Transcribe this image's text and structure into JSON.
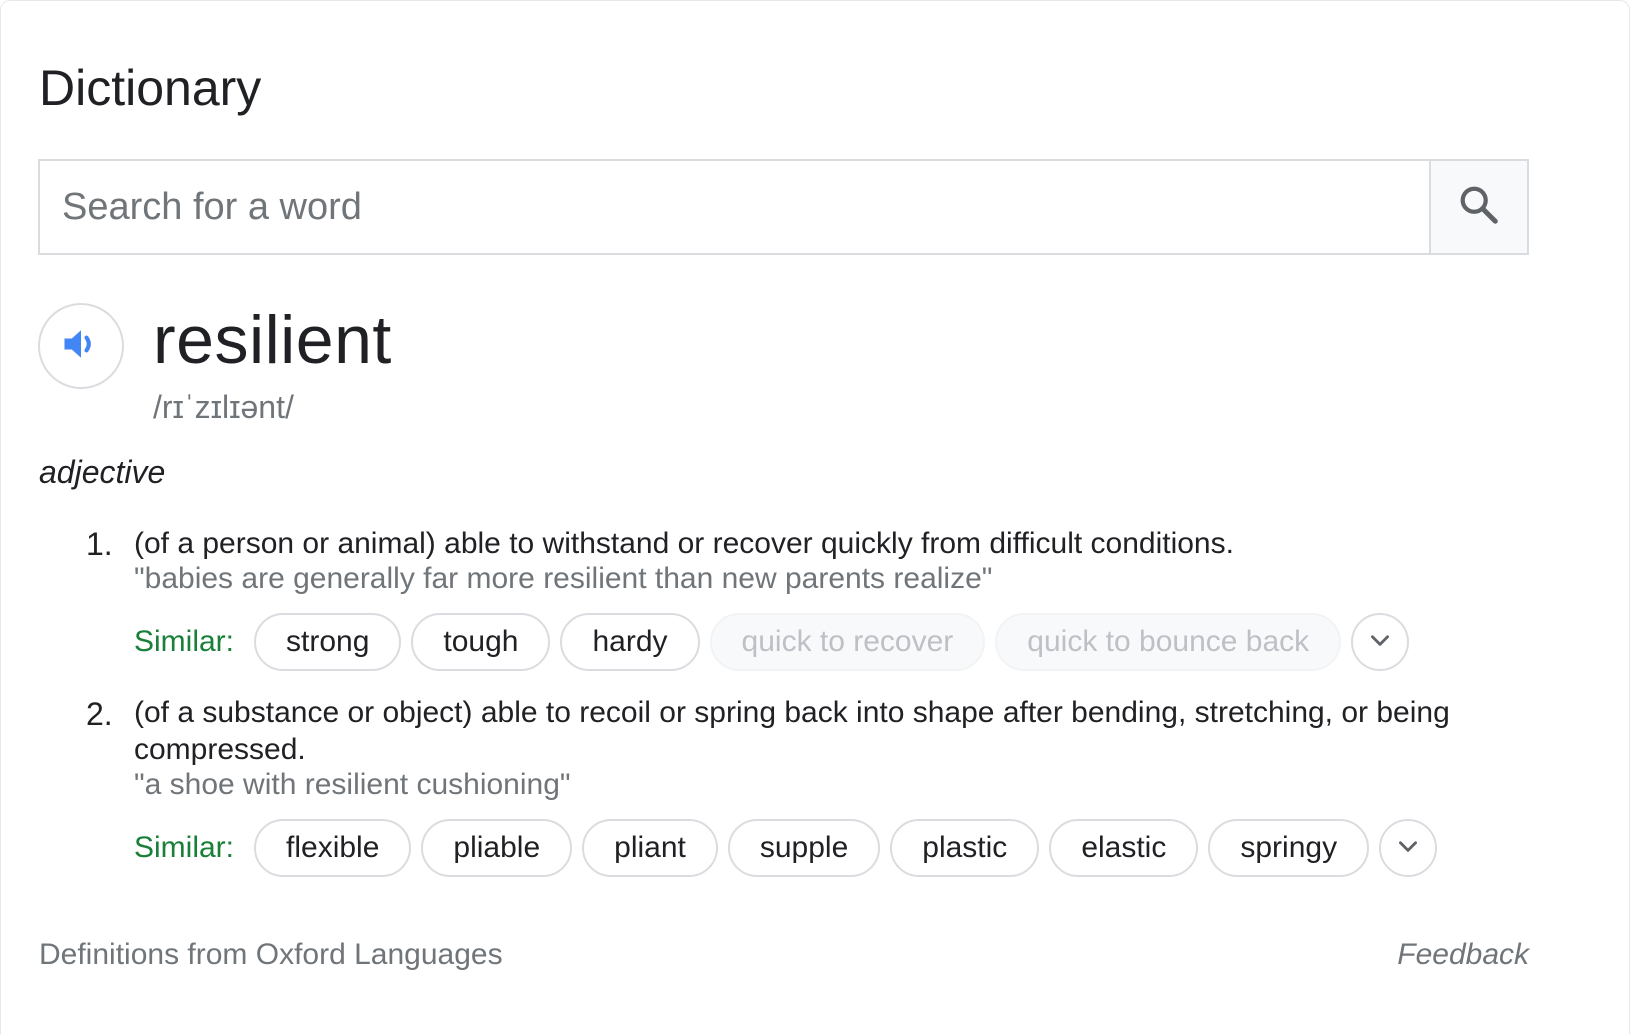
{
  "header": {
    "title": "Dictionary"
  },
  "search": {
    "placeholder": "Search for a word",
    "value": ""
  },
  "entry": {
    "word": "resilient",
    "phonetic": "/rɪˈzɪlɪənt/",
    "part_of_speech": "adjective"
  },
  "senses": [
    {
      "number": "1.",
      "definition": "(of a person or animal) able to withstand or recover quickly from difficult conditions.",
      "example": "\"babies are generally far more resilient than new parents realize\"",
      "similar_label": "Similar:",
      "similar": [
        "strong",
        "tough",
        "hardy",
        "quick to recover",
        "quick to bounce back"
      ]
    },
    {
      "number": "2.",
      "definition": "(of a substance or object) able to recoil or spring back into shape after bending, stretching, or being compressed.",
      "example": "\"a shoe with resilient cushioning\"",
      "similar_label": "Similar:",
      "similar": [
        "flexible",
        "pliable",
        "pliant",
        "supple",
        "plastic",
        "elastic",
        "springy"
      ]
    }
  ],
  "footer": {
    "source": "Definitions from Oxford Languages",
    "feedback": "Feedback"
  },
  "icons": {
    "search": "search-icon",
    "speaker": "speaker-icon",
    "expand": "chevron-down-icon"
  },
  "colors": {
    "accent": "#4285f4",
    "similar_label": "#188038",
    "muted_text": "#70757a"
  }
}
